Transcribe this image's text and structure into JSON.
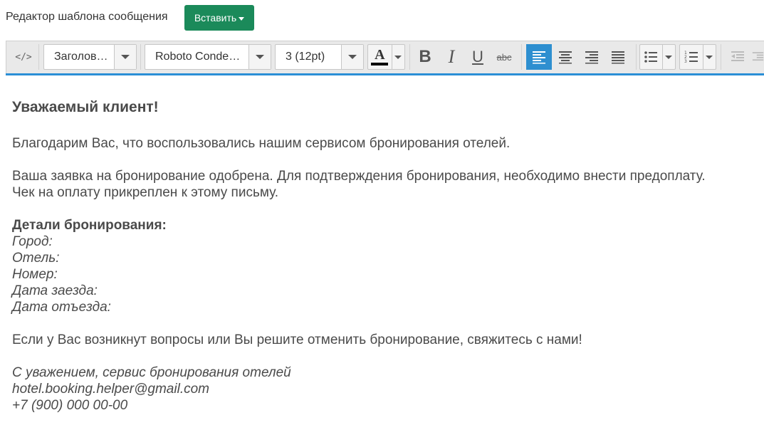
{
  "header": {
    "label": "Редактор шаблона сообщения",
    "insert_button": "Вставить"
  },
  "toolbar": {
    "source_button": "</>",
    "format_value": "Заголов…",
    "font_value": "Roboto Conde…",
    "size_value": "3 (12pt)",
    "color_letter": "A",
    "bold_letter": "B",
    "italic_letter": "I",
    "underline_letter": "U",
    "strike_label": "abc",
    "colors": {
      "accent": "#2b8fd6",
      "insert_green": "#1b8a5a",
      "active": "#2e8fd0",
      "text_color_swatch": "#000000"
    }
  },
  "document": {
    "heading": "Уважаемый клиент!",
    "para1": "Благодарим Вас, что воспользовались нашим сервисом бронирования отелей.",
    "para2_line1": "Ваша заявка на бронирование одобрена. Для подтверждения бронирования, необходимо внести предоплату.",
    "para2_line2": "Чек на оплату прикреплен к этому письму.",
    "details_title": "Детали бронирования:",
    "details": [
      "Город:",
      "Отель:",
      "Номер:",
      "Дата заезда:",
      "Дата отъезда:"
    ],
    "para3": "Если у Вас возникнут вопросы или Вы решите отменить бронирование, свяжитесь с нами!",
    "signature": [
      "С уважением, сервис бронирования отелей",
      "hotel.booking.helper@gmail.com",
      "+7 (900) 000 00-00"
    ]
  }
}
